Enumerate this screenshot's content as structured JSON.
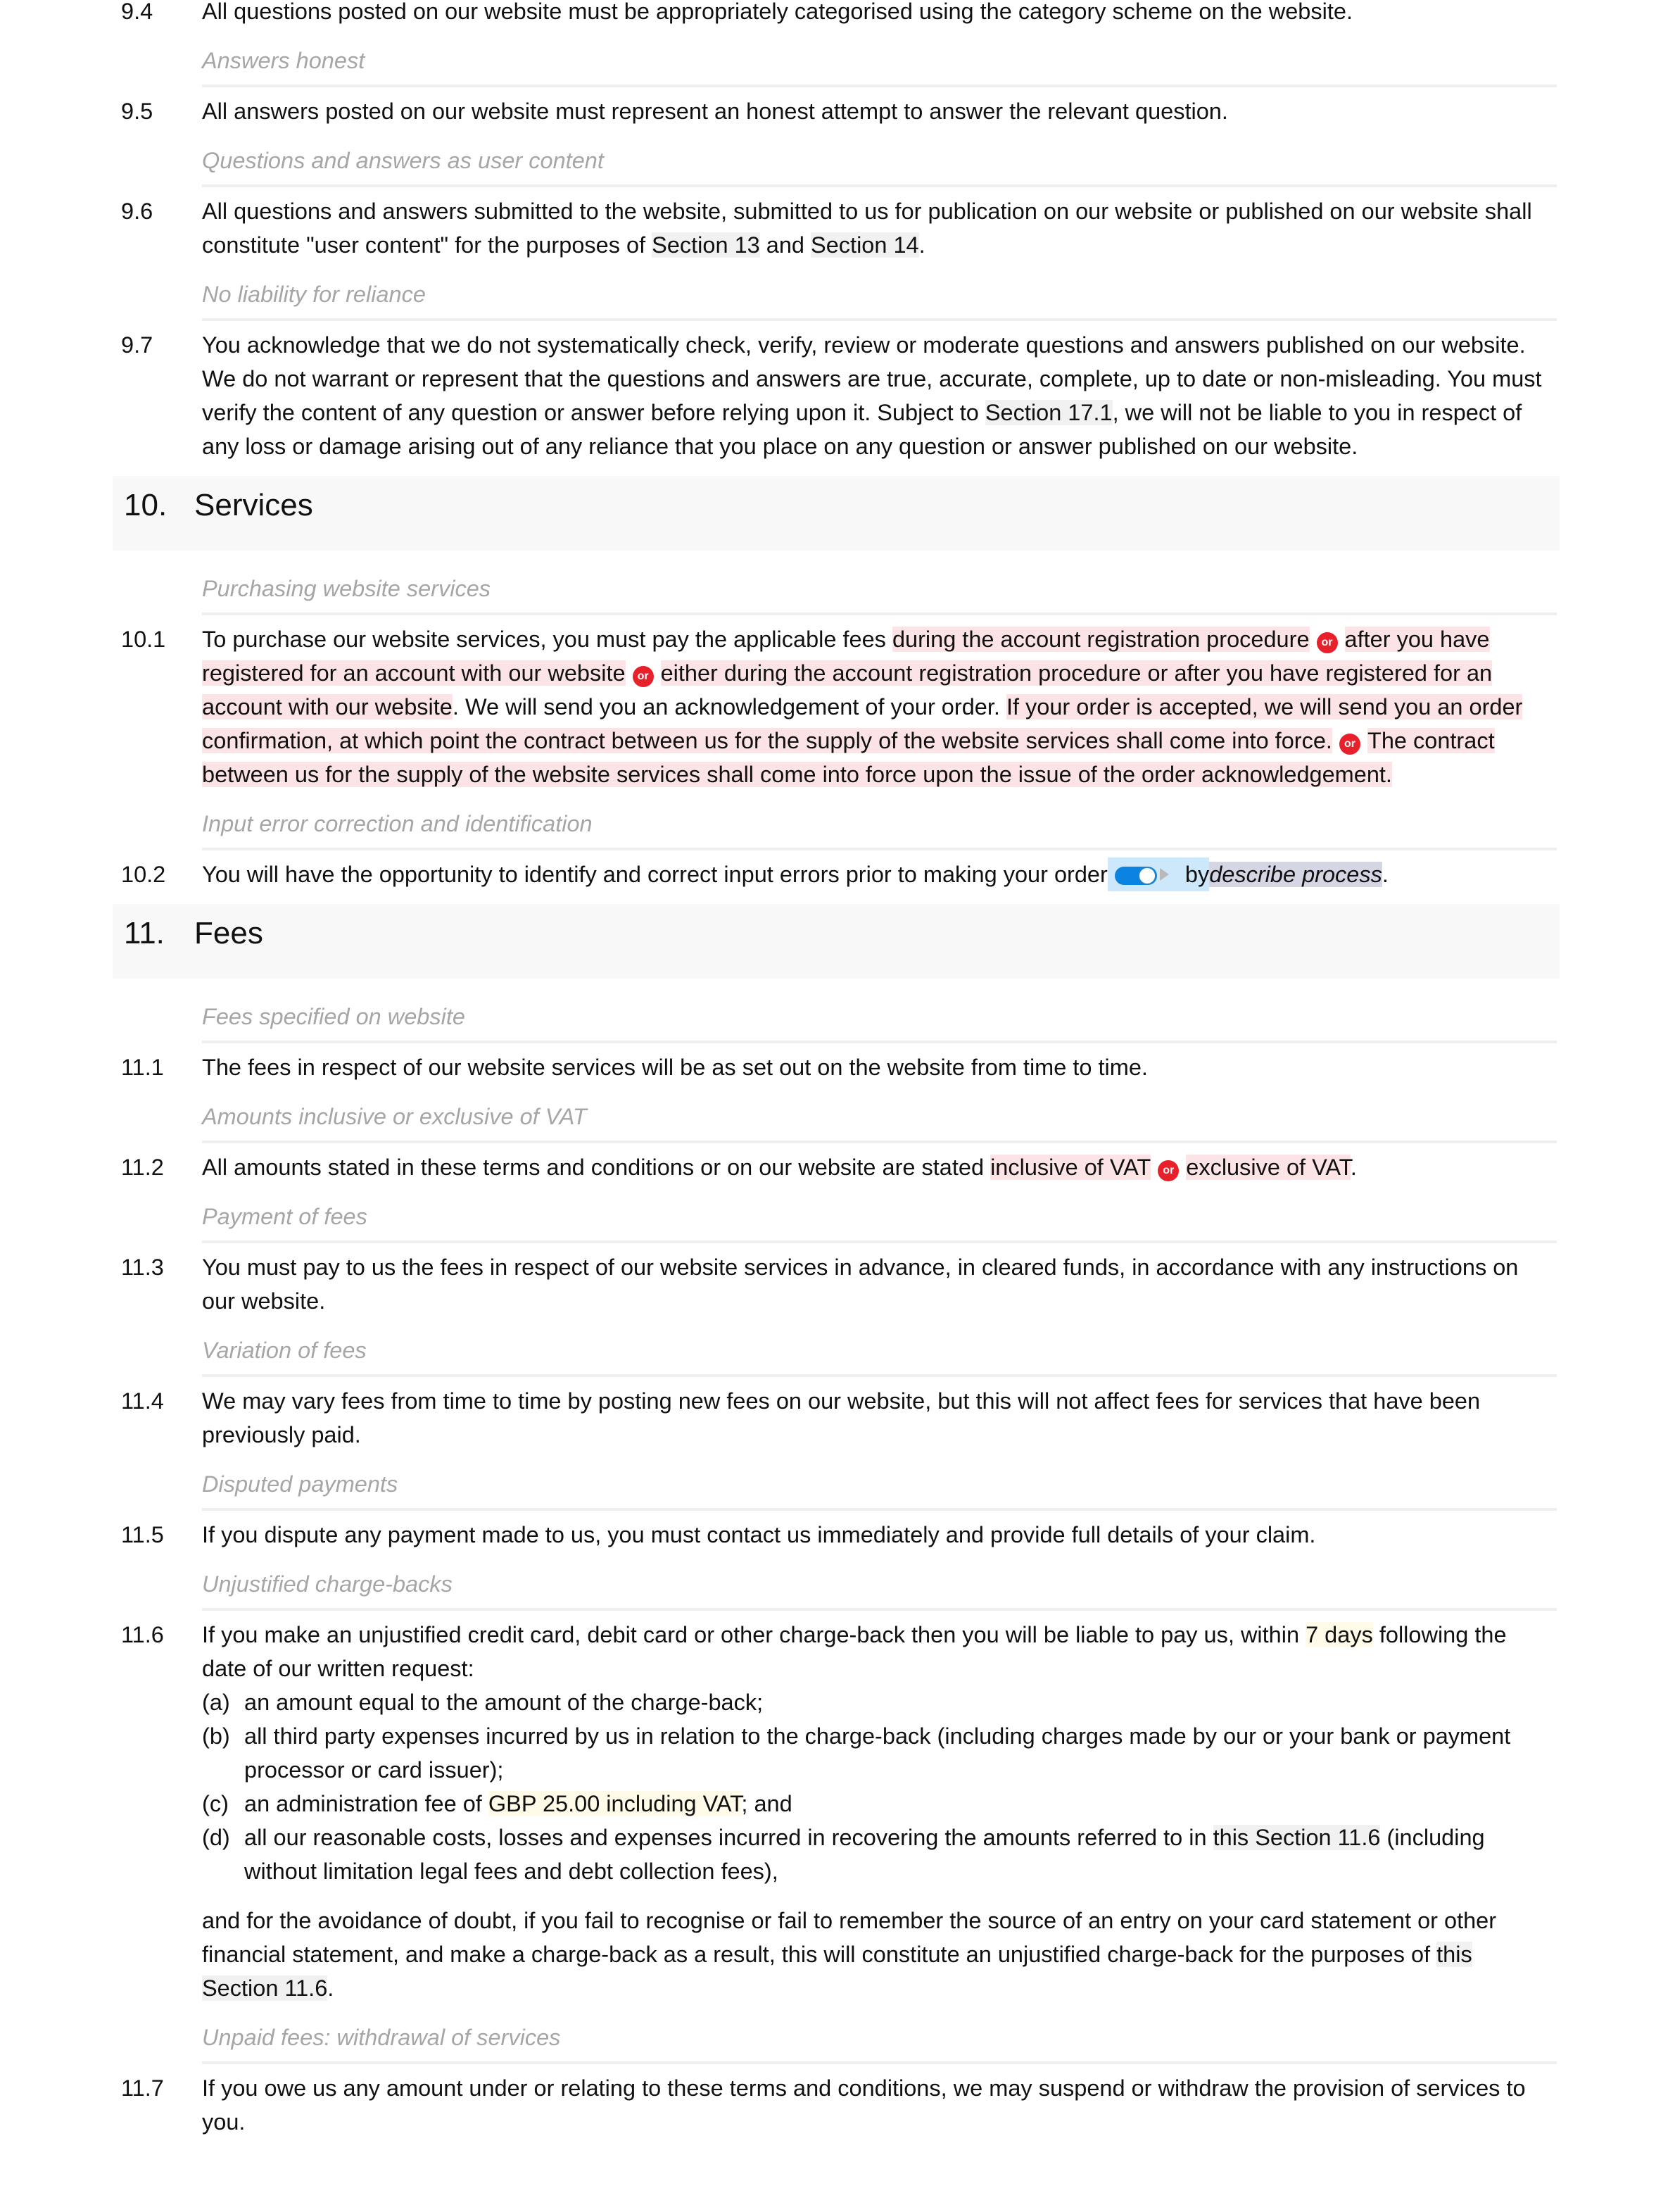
{
  "clauses_9": [
    {
      "num": "9.4",
      "text": "All questions posted on our website must be appropriately categorised using the category scheme on the website."
    },
    {
      "subheading": "Answers honest"
    },
    {
      "num": "9.5",
      "text": "All answers posted on our website must represent an honest attempt to answer the relevant question."
    },
    {
      "subheading": "Questions and answers as user content"
    },
    {
      "num": "9.6",
      "text_a": "All questions and answers submitted to the website, submitted to us for publication on our website or published on our website shall constitute \"user content\" for the purposes of ",
      "xref1": "Section 13",
      "text_b": " and ",
      "xref2": "Section 14",
      "text_c": "."
    },
    {
      "subheading": "No liability for reliance"
    },
    {
      "num": "9.7",
      "text_a": "You acknowledge that we do not systematically check, verify, review or moderate questions and answers published on our website. We do not warrant or represent that the questions and answers are true, accurate, complete, up to date or non-misleading. You must verify the content of any question or answer before relying upon it. Subject to ",
      "xref": "Section 17.1",
      "text_b": ", we will not be liable to you in respect of any loss or damage arising out of any reliance that you place on any question or answer published on our website."
    }
  ],
  "section_10": {
    "num": "10.",
    "title": "Services",
    "sub1": "Purchasing website services",
    "c1": {
      "num": "10.1",
      "t1": "To purchase our website services, you must pay the applicable fees ",
      "o1": "during the account registration procedure",
      "or": "or",
      "o2": "after you have registered for an account with our website",
      "o3": "either during the account registration procedure or after you have registered for an account with our website",
      "t2": ". We will send you an acknowledgement of your order. ",
      "o4": "If your order is accepted, we will send you an order confirmation, at which point the contract between us for the supply of the website services shall come into force.",
      "o5": "The contract between us for the supply of the website services shall come into force upon the issue of the order acknowledgement."
    },
    "sub2": "Input error correction and identification",
    "c2": {
      "num": "10.2",
      "t1": "You will have the opportunity to identify and correct input errors prior to making your order",
      "toggle_on": true,
      "t2": " by ",
      "placeholder": "describe process",
      "t3": "."
    }
  },
  "section_11": {
    "num": "11.",
    "title": "Fees",
    "items": {
      "s1": "Fees specified on website",
      "c1": {
        "num": "11.1",
        "text": "The fees in respect of our website services will be as set out on the website from time to time."
      },
      "s2": "Amounts inclusive or exclusive of VAT",
      "c2": {
        "num": "11.2",
        "t1": "All amounts stated in these terms and conditions or on our website are stated ",
        "o1": "inclusive of VAT",
        "or": "or",
        "o2": "exclusive of VAT",
        "t2": "."
      },
      "s3": "Payment of fees",
      "c3": {
        "num": "11.3",
        "text": "You must pay to us the fees in respect of our website services in advance, in cleared funds, in accordance with any instructions on our website."
      },
      "s4": "Variation of fees",
      "c4": {
        "num": "11.4",
        "text": "We may vary fees from time to time by posting new fees on our website, but this will not affect fees for services that have been previously paid."
      },
      "s5": "Disputed payments",
      "c5": {
        "num": "11.5",
        "text": "If you dispute any payment made to us, you must contact us immediately and provide full details of your claim."
      },
      "s6": "Unjustified charge-backs",
      "c6": {
        "num": "11.6",
        "t1": "If you make an unjustified credit card, debit card or other charge-back then you will be liable to pay us, within ",
        "v1": "7 days",
        "t2": " following the date of our written request:",
        "a_label": "(a)",
        "a": "an amount equal to the amount of the charge-back;",
        "b_label": "(b)",
        "b": "all third party expenses incurred by us in relation to the charge-back (including charges made by our or your bank or payment processor or card issuer);",
        "c_label": "(c)",
        "c_t1": "an administration fee of ",
        "c_v": "GBP 25.00 including VAT",
        "c_t2": "; and",
        "d_label": "(d)",
        "d_t1": "all our reasonable costs, losses and expenses incurred in recovering the amounts referred to in ",
        "d_x": "this Section 11.6",
        "d_t2": " (including without limitation legal fees and debt collection fees),",
        "tail_t1": "and for the avoidance of doubt, if you fail to recognise or fail to remember the source of an entry on your card statement or other financial statement, and make a charge-back as a result, this will constitute an unjustified charge-back for the purposes of ",
        "tail_x": "this Section 11.6",
        "tail_t2": "."
      },
      "s7": "Unpaid fees: withdrawal of services",
      "c7": {
        "num": "11.7",
        "text": "If you owe us any amount under or relating to these terms and conditions, we may suspend or withdraw the provision of services to you."
      }
    }
  },
  "colors": {
    "option_highlight": "#fce4e6",
    "or_badge": "#e8202a",
    "variable_highlight": "#fffbe8",
    "cross_reference": "#f1f1f1",
    "toggle_on": "#0a84e0",
    "toggle_bg": "#cde8fb",
    "editable_field": "#d5d6e4",
    "subheading_text": "#a6a6a6"
  }
}
